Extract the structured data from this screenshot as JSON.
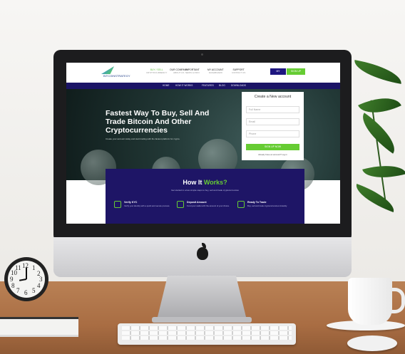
{
  "site": {
    "logo_text": "BITCOINSTRATEGY",
    "nav": [
      {
        "label": "BUY / SELL",
        "sub": "CRYPTOCURRENCY"
      },
      {
        "label": "OUR COMPANY",
        "sub": "ABOUT US"
      },
      {
        "label": "IMPORTANT",
        "sub": "NEWS & INFO"
      },
      {
        "label": "MY ACCOUNT",
        "sub": "DASHBOARD"
      },
      {
        "label": "SUPPORT",
        "sub": "CONTACT US"
      }
    ],
    "login_label": "MY ACCOUNT",
    "signup_label": "SIGN UP",
    "subnav": [
      "HOME",
      "HOW IT WORKS",
      "FEATURES",
      "BLOG",
      "DOWNLOADS"
    ],
    "hero": {
      "title": "Fastest Way To Buy, Sell And Trade Bitcoin And Other Cryptocurrencies",
      "paragraph": "Create your account today and start trading with the fastest platform for crypto."
    },
    "form": {
      "title": "Create a New account",
      "fields": [
        "Full Name",
        "Email",
        "Phone"
      ],
      "button": "SIGN UP NOW",
      "note": "Already have an account? Log in"
    },
    "how": {
      "title_main": "How It ",
      "title_accent": "Works?",
      "subtitle": "Get started in a few simple steps to buy, sell and trade cryptocurrencies",
      "steps": [
        {
          "title": "Verify KYC",
          "desc": "Verify your identity with a quick and secure process."
        },
        {
          "title": "Deposit Amount",
          "desc": "Fund your wallet with the amount of your choice."
        },
        {
          "title": "Ready To Trade",
          "desc": "Buy, sell and trade cryptocurrencies instantly."
        }
      ]
    }
  },
  "clock_numbers": [
    "12",
    "1",
    "2",
    "3",
    "4",
    "5",
    "6",
    "7",
    "8",
    "9",
    "10",
    "11"
  ],
  "colors": {
    "brand_dark": "#1e1566",
    "accent_green": "#66cc33",
    "desk": "#a96d43"
  }
}
